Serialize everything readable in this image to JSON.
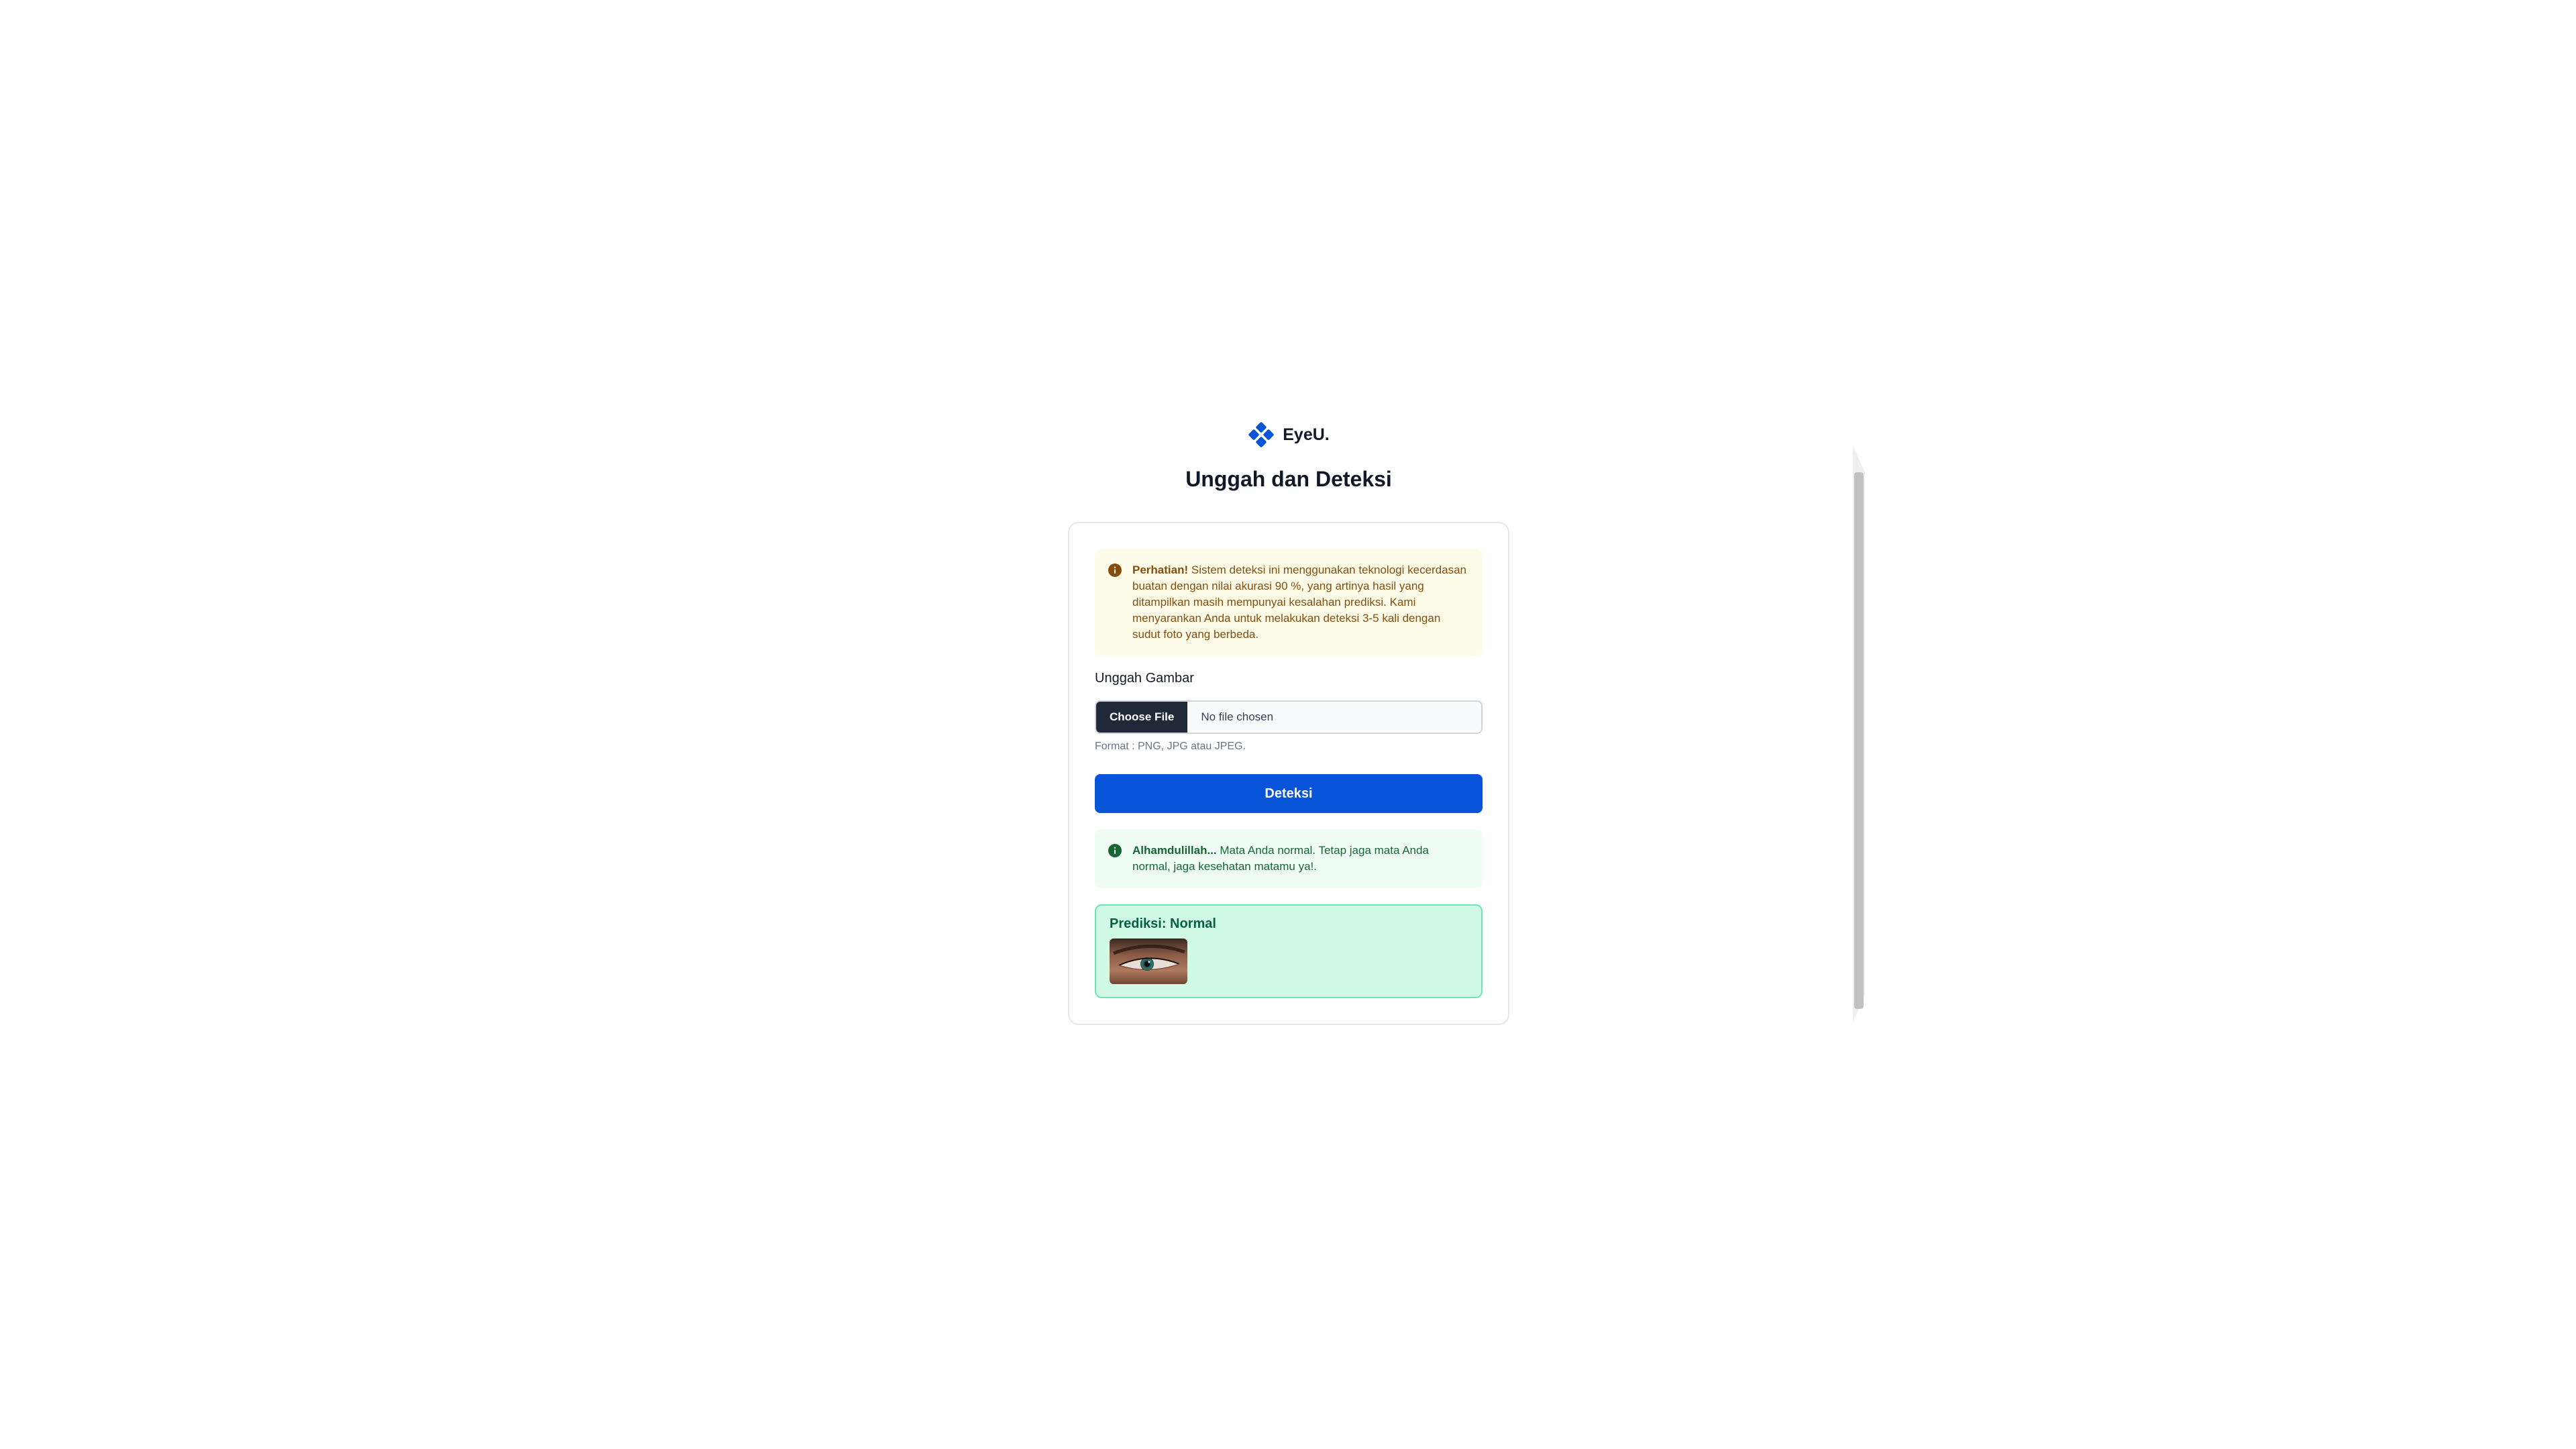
{
  "brand": {
    "name": "EyeU.",
    "accent_color": "#0754d8"
  },
  "page": {
    "title": "Unggah dan Deteksi"
  },
  "warning": {
    "icon": "info-icon",
    "title": "Perhatian!",
    "text": " Sistem deteksi ini menggunakan teknologi kecerdasan buatan dengan nilai akurasi 90 %, yang artinya hasil yang ditampilkan masih mempunyai kesalahan prediksi. Kami menyarankan Anda untuk melakukan deteksi 3-5 kali dengan sudut foto yang berbeda.",
    "color": "#854d0e"
  },
  "upload": {
    "label": "Unggah Gambar",
    "button_label": "Choose File",
    "file_status": "No file chosen",
    "hint": "Format : PNG, JPG atau JPEG."
  },
  "submit": {
    "label": "Deteksi"
  },
  "success": {
    "icon": "info-icon",
    "title": "Alhamdulillah...",
    "text": " Mata Anda normal. Tetap jaga mata Anda normal, jaga kesehatan matamu ya!.",
    "color": "#166534"
  },
  "result": {
    "title": "Prediksi: Normal",
    "image": "eye-photo"
  }
}
